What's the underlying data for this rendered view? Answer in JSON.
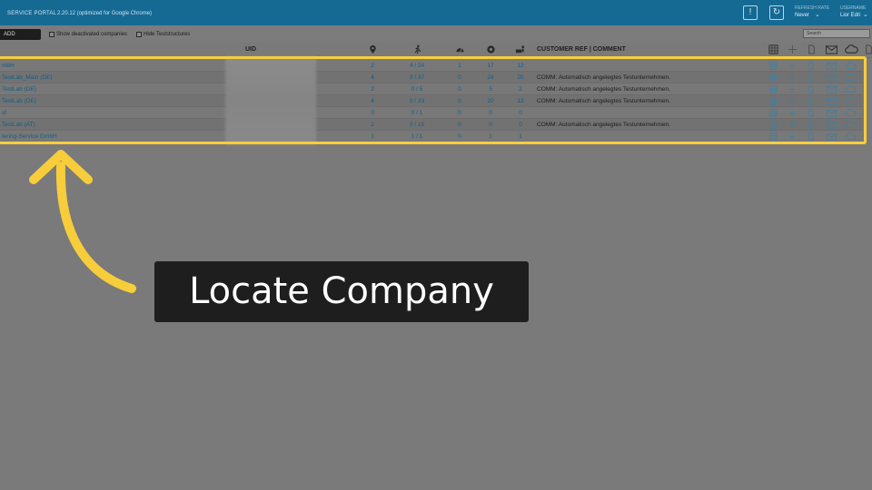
{
  "header": {
    "app_title": "SERVICE PORTAL",
    "version": "2.20.12   (optimized for Google Chrome)",
    "refresh_label": "REFRESH RATE",
    "refresh_value": "Never",
    "username_label": "USERNAME",
    "username_value": "Lior Edri"
  },
  "toolbar": {
    "company_select": "ADD",
    "show_deactivated": "Show deactivated companies",
    "hide_teststructures": "Hide Teststructures",
    "search_placeholder": "Search"
  },
  "columns": {
    "uid": "UID",
    "comment": "CUSTOMER REF | COMMENT",
    "icons": [
      "location-pin-icon",
      "person-running-icon",
      "speedometer-icon",
      "gear-icon",
      "car-person-icon"
    ],
    "action_icons": [
      "grid-icon",
      "plus-icon",
      "document-icon",
      "mail-icon",
      "cloud-icon"
    ]
  },
  "rows": [
    {
      "name": "mbH",
      "c1": "2",
      "c2": "4 / 24",
      "c3": "1",
      "c4": "17",
      "c5": "12",
      "comment": ""
    },
    {
      "name": "TestLab_Main (DE)",
      "c1": "4",
      "c2": "0 / 37",
      "c3": "0",
      "c4": "24",
      "c5": "20",
      "comment": "COMM: Automatisch angelegtes Testunternehmen."
    },
    {
      "name": "TestLab (DE)",
      "c1": "2",
      "c2": "0 / 5",
      "c3": "0",
      "c4": "5",
      "c5": "2",
      "comment": "COMM: Automatisch angelegtes Testunternehmen."
    },
    {
      "name": "TestLab (DE)",
      "c1": "4",
      "c2": "0 / 23",
      "c3": "0",
      "c4": "20",
      "c5": "13",
      "comment": "COMM: Automatisch angelegtes Testunternehmen."
    },
    {
      "name": "st",
      "c1": "0",
      "c2": "0 / 1",
      "c3": "0",
      "c4": "0",
      "c5": "0",
      "comment": ""
    },
    {
      "name": "TestLab (AT)",
      "c1": "2",
      "c2": "0 / 15",
      "c3": "0",
      "c4": "0",
      "c5": "0",
      "comment": "COMM: Automatisch angelegtes Testunternehmen."
    },
    {
      "name": "tering-Service GmbH",
      "c1": "1",
      "c2": "1 / 1",
      "c3": "0",
      "c4": "1",
      "c5": "1",
      "comment": ""
    }
  ],
  "callout": {
    "text": "Locate Company"
  },
  "colors": {
    "header_bg": "#156a94",
    "highlight": "#f7cd3b",
    "link": "#0f5f86"
  }
}
